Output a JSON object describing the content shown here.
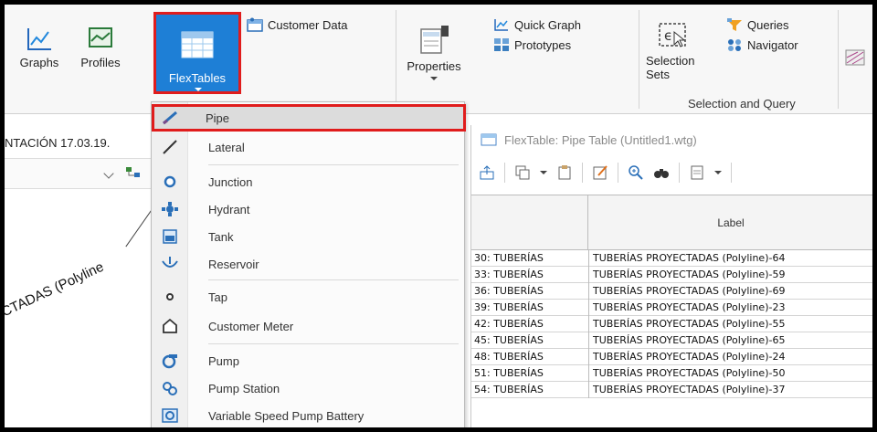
{
  "ribbon": {
    "graphs_label": "Graphs",
    "profiles_label": "Profiles",
    "flextables_label": "FlexTables",
    "customer_data_label": "Customer Data",
    "properties_label": "Properties",
    "quick_graph_label": "Quick Graph",
    "prototypes_label": "Prototypes",
    "selection_sets_label": "Selection Sets",
    "queries_label": "Queries",
    "navigator_label": "Navigator",
    "group_selection_query": "Selection and Query"
  },
  "left_panel": {
    "title": "NTACIÓN 17.03.19.",
    "drawing_label": "CTADAS (Polyline"
  },
  "menu": {
    "items": [
      {
        "label": "Pipe",
        "icon": "pipe-icon"
      },
      {
        "label": "Lateral",
        "icon": "lateral-icon"
      },
      {
        "label": "Junction",
        "icon": "junction-icon"
      },
      {
        "label": "Hydrant",
        "icon": "hydrant-icon"
      },
      {
        "label": "Tank",
        "icon": "tank-icon"
      },
      {
        "label": "Reservoir",
        "icon": "reservoir-icon"
      },
      {
        "label": "Tap",
        "icon": "tap-icon"
      },
      {
        "label": "Customer Meter",
        "icon": "customer-meter-icon"
      },
      {
        "label": "Pump",
        "icon": "pump-icon"
      },
      {
        "label": "Pump Station",
        "icon": "pump-station-icon"
      },
      {
        "label": "Variable Speed Pump Battery",
        "icon": "vspb-icon"
      }
    ]
  },
  "flextable": {
    "title": "FlexTable: Pipe Table (Untitled1.wtg)",
    "column_label": "Label",
    "rows": [
      {
        "id": "30: TUBERÍAS",
        "label": "TUBERÍAS PROYECTADAS (Polyline)-64"
      },
      {
        "id": "33: TUBERÍAS",
        "label": "TUBERÍAS PROYECTADAS (Polyline)-59"
      },
      {
        "id": "36: TUBERÍAS",
        "label": "TUBERÍAS PROYECTADAS (Polyline)-69"
      },
      {
        "id": "39: TUBERÍAS",
        "label": "TUBERÍAS PROYECTADAS (Polyline)-23"
      },
      {
        "id": "42: TUBERÍAS",
        "label": "TUBERÍAS PROYECTADAS (Polyline)-55"
      },
      {
        "id": "45: TUBERÍAS",
        "label": "TUBERÍAS PROYECTADAS (Polyline)-65"
      },
      {
        "id": "48: TUBERÍAS",
        "label": "TUBERÍAS PROYECTADAS (Polyline)-24"
      },
      {
        "id": "51: TUBERÍAS",
        "label": "TUBERÍAS PROYECTADAS (Polyline)-50"
      },
      {
        "id": "54: TUBERÍAS",
        "label": "TUBERÍAS PROYECTADAS (Polyline)-37"
      }
    ]
  },
  "colors": {
    "flextables_active": "#1e7fd6",
    "highlight_border": "#e01c1c"
  }
}
